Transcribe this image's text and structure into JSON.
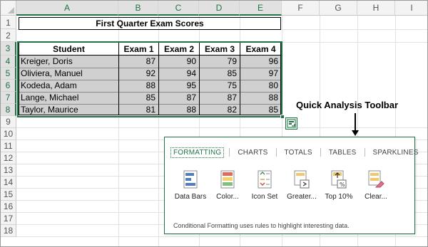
{
  "columns": [
    "A",
    "B",
    "C",
    "D",
    "E",
    "F",
    "G",
    "H",
    "I"
  ],
  "rows": [
    "1",
    "2",
    "3",
    "4",
    "5",
    "6",
    "7",
    "8",
    "9",
    "10",
    "11",
    "12",
    "13",
    "14",
    "15",
    "16",
    "17",
    "18"
  ],
  "sheet": {
    "title": "First Quarter Exam Scores",
    "headers": [
      "Student",
      "Exam 1",
      "Exam 2",
      "Exam 3",
      "Exam 4"
    ],
    "students": [
      {
        "name": "Kreiger, Doris",
        "scores": [
          "87",
          "90",
          "79",
          "96"
        ]
      },
      {
        "name": "Oliviera, Manuel",
        "scores": [
          "92",
          "94",
          "85",
          "97"
        ]
      },
      {
        "name": "Kodeda, Adam",
        "scores": [
          "88",
          "95",
          "75",
          "80"
        ]
      },
      {
        "name": "Lange, Michael",
        "scores": [
          "85",
          "87",
          "87",
          "88"
        ]
      },
      {
        "name": "Taylor, Maurice",
        "scores": [
          "81",
          "88",
          "82",
          "85"
        ]
      }
    ]
  },
  "annotation": "Quick Analysis Toolbar",
  "quick_analysis": {
    "tabs": [
      "FORMATTING",
      "CHARTS",
      "TOTALS",
      "TABLES",
      "SPARKLINES"
    ],
    "tools": [
      {
        "label": "Data Bars",
        "icon": "data-bars-icon"
      },
      {
        "label": "Color...",
        "icon": "color-scale-icon"
      },
      {
        "label": "Icon Set",
        "icon": "icon-set-icon"
      },
      {
        "label": "Greater...",
        "icon": "greater-than-icon"
      },
      {
        "label": "Top 10%",
        "icon": "top-10-icon"
      },
      {
        "label": "Clear...",
        "icon": "clear-format-icon"
      }
    ],
    "description": "Conditional Formatting uses rules to highlight interesting data."
  },
  "colors": {
    "accent": "#217346",
    "selection_fill": "#d0d0d0"
  }
}
